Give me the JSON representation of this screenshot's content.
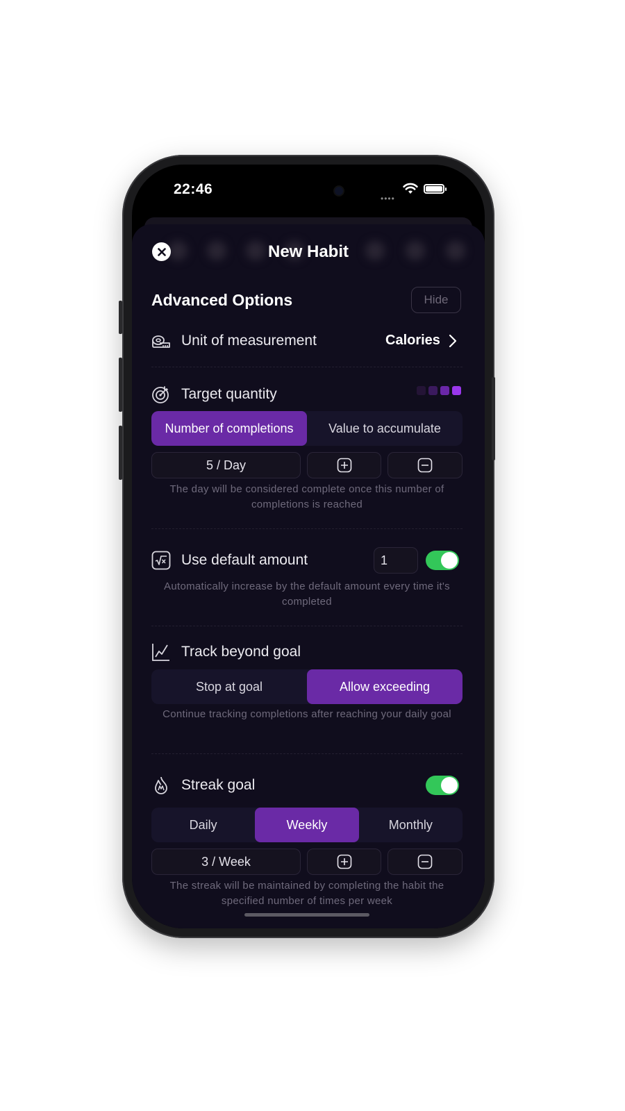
{
  "status_bar": {
    "time": "22:46"
  },
  "header": {
    "title": "New Habit"
  },
  "advanced": {
    "title": "Advanced Options",
    "hide_label": "Hide"
  },
  "unit": {
    "label": "Unit of measurement",
    "value": "Calories"
  },
  "target": {
    "label": "Target quantity",
    "options": [
      "Number of completions",
      "Value to accumulate"
    ],
    "selected": "Number of completions",
    "value": "5 / Day",
    "hint": "The day will be considered complete once this number of completions is reached"
  },
  "default_amount": {
    "label": "Use default amount",
    "value": "1",
    "enabled": true,
    "hint": "Automatically increase by the default amount every time it's completed"
  },
  "beyond_goal": {
    "label": "Track beyond goal",
    "options": [
      "Stop at goal",
      "Allow exceeding"
    ],
    "selected": "Allow exceeding",
    "hint": "Continue tracking completions after reaching your daily goal"
  },
  "streak": {
    "label": "Streak goal",
    "enabled": true,
    "options": [
      "Daily",
      "Weekly",
      "Monthly"
    ],
    "selected": "Weekly",
    "value": "3 / Week",
    "hint": "The streak will be maintained by completing the habit the specified number of times per week"
  },
  "colors": {
    "accent": "#6a2aa6",
    "toggle_on": "#33c759",
    "background": "#100d1d"
  }
}
